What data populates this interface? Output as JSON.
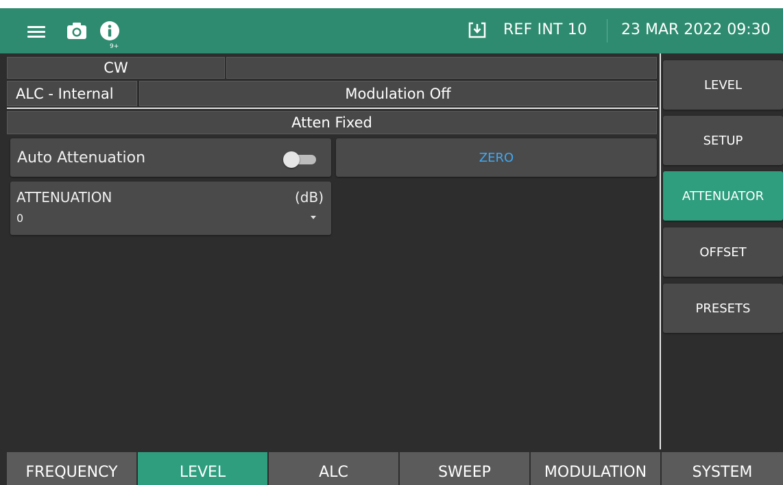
{
  "topbar": {
    "menu_icon": "hamburger-menu-icon",
    "camera_icon": "camera-icon",
    "info_icon": "info-icon",
    "notification_badge": "9+",
    "ref_icon": "download-box-icon",
    "ref_text": "REF INT 10",
    "datetime": "23 MAR 2022 09:30"
  },
  "status": {
    "mode": "CW",
    "mode_detail": "",
    "alc": "ALC - Internal",
    "modulation": "Modulation Off",
    "atten_state": "Atten Fixed"
  },
  "main": {
    "auto_attenuation_label": "Auto Attenuation",
    "auto_attenuation_on": false,
    "zero_button": "ZERO",
    "attenuation": {
      "label": "ATTENUATION",
      "unit": "(dB)",
      "value": "0"
    }
  },
  "side_nav": {
    "items": [
      {
        "label": "LEVEL",
        "active": false
      },
      {
        "label": "SETUP",
        "active": false
      },
      {
        "label": "ATTENUATOR",
        "active": true
      },
      {
        "label": "OFFSET",
        "active": false
      },
      {
        "label": "PRESETS",
        "active": false
      }
    ]
  },
  "bottom_tabs": {
    "items": [
      {
        "label": "FREQUENCY",
        "active": false
      },
      {
        "label": "LEVEL",
        "active": true
      },
      {
        "label": "ALC",
        "active": false
      },
      {
        "label": "SWEEP",
        "active": false
      },
      {
        "label": "MODULATION",
        "active": false
      },
      {
        "label": "SYSTEM",
        "active": false
      }
    ]
  },
  "colors": {
    "accent": "#2e9e7e",
    "topbar": "#2e8b6f",
    "background": "#2d2d2d",
    "panel": "#4a4a4a",
    "link": "#3fa9f5"
  }
}
